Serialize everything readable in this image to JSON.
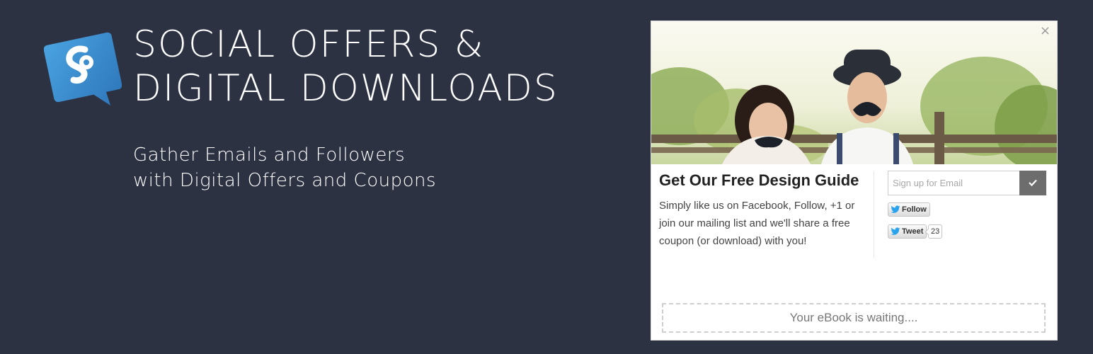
{
  "banner": {
    "headline_line1": "SOCIAL OFFERS &",
    "headline_line2": "DIGITAL DOWNLOADS",
    "subtitle_line1": "Gather Emails and Followers",
    "subtitle_line2": "with Digital Offers and Coupons",
    "logo_icon": "speech-bubble-s-logo",
    "colors": {
      "background": "#2d3243",
      "logo": "#3a8fd0",
      "text": "#ffffff"
    }
  },
  "popup": {
    "close_label": "×",
    "hero_icon": "couple-with-mustache-props-photo",
    "title": "Get Our Free Design Guide",
    "description": "Simply like us on Facebook, Follow, +1 or join our mailing list and we'll share a free coupon (or download) with you!",
    "email": {
      "placeholder": "Sign up for Email",
      "submit_icon": "check-icon"
    },
    "twitter": {
      "follow_label": "Follow",
      "tweet_label": "Tweet",
      "tweet_count": "23"
    },
    "waiting_text": "Your eBook is waiting...."
  }
}
